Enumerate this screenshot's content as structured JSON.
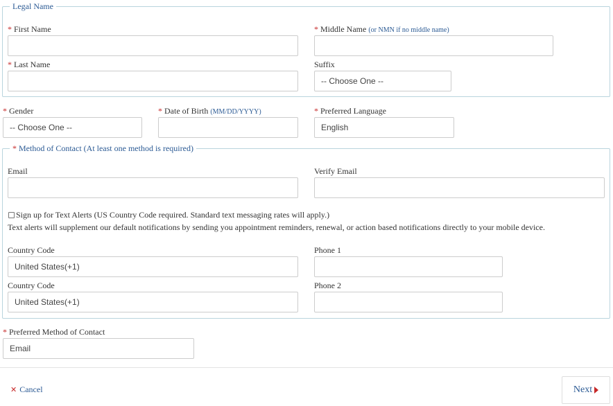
{
  "legal_name": {
    "legend": "Legal Name",
    "first_name": {
      "label": "First Name",
      "value": ""
    },
    "middle_name": {
      "label": "Middle Name",
      "hint": "(or NMN if no middle name)",
      "value": ""
    },
    "last_name": {
      "label": "Last Name",
      "value": ""
    },
    "suffix": {
      "label": "Suffix",
      "selected": "-- Choose One --"
    }
  },
  "gender": {
    "label": "Gender",
    "selected": "-- Choose One --"
  },
  "dob": {
    "label": "Date of Birth",
    "hint": "(MM/DD/YYYY)",
    "value": ""
  },
  "language": {
    "label": "Preferred Language",
    "selected": "English"
  },
  "contact": {
    "legend": "Method of Contact (At least one method is required)",
    "email": {
      "label": "Email",
      "value": ""
    },
    "verify_email": {
      "label": "Verify Email",
      "value": ""
    },
    "text_alerts": {
      "label": "Sign up for Text Alerts (US Country Code required. Standard text messaging rates will apply.)",
      "checked": false,
      "description": "Text alerts will supplement our default notifications by sending you appointment reminders, renewal, or action based notifications directly to your mobile device."
    },
    "country_code_1": {
      "label": "Country Code",
      "selected": "United States(+1)"
    },
    "phone_1": {
      "label": "Phone 1",
      "value": ""
    },
    "country_code_2": {
      "label": "Country Code",
      "selected": "United States(+1)"
    },
    "phone_2": {
      "label": "Phone 2",
      "value": ""
    }
  },
  "preferred_contact": {
    "label": "Preferred Method of Contact",
    "selected": "Email"
  },
  "required_marker": "*",
  "actions": {
    "cancel": "Cancel",
    "next": "Next"
  },
  "colors": {
    "accent": "#2b5a94",
    "required": "#c62828",
    "border": "#b9d4dd"
  }
}
